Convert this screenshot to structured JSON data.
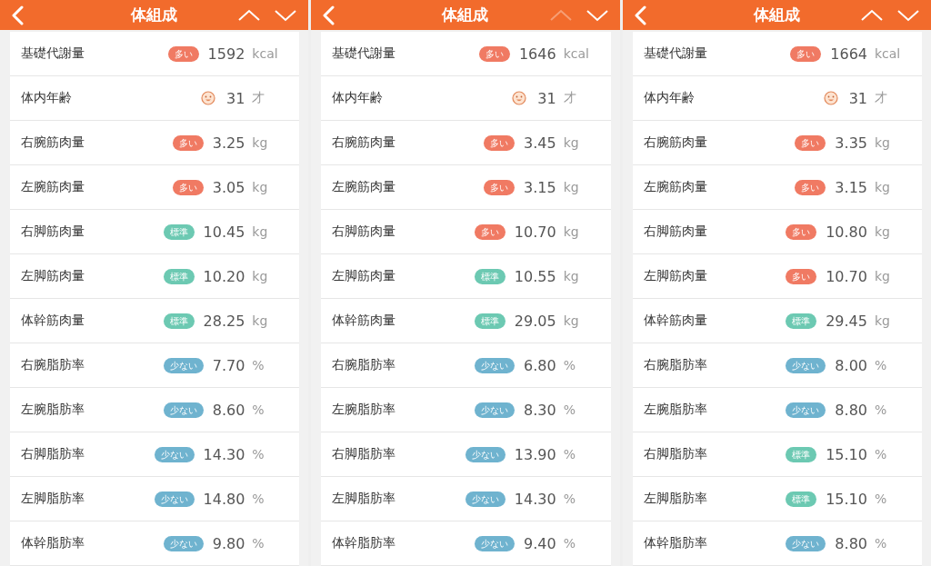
{
  "panels": [
    {
      "title": "体組成",
      "nav_up_disabled": false,
      "nav_down_disabled": false,
      "rows": [
        {
          "kind": "badge",
          "label": "基礎代謝量",
          "badge": {
            "text": "多い",
            "color": "#f07a63"
          },
          "value": "1592",
          "unit": "kcal"
        },
        {
          "kind": "face",
          "label": "体内年齢",
          "value": "31",
          "unit": "才"
        },
        {
          "kind": "badge",
          "label": "右腕筋肉量",
          "badge": {
            "text": "多い",
            "color": "#f07a63"
          },
          "value": "3.25",
          "unit": "kg"
        },
        {
          "kind": "badge",
          "label": "左腕筋肉量",
          "badge": {
            "text": "多い",
            "color": "#f07a63"
          },
          "value": "3.05",
          "unit": "kg"
        },
        {
          "kind": "badge",
          "label": "右脚筋肉量",
          "badge": {
            "text": "標準",
            "color": "#6cc9b2"
          },
          "value": "10.45",
          "unit": "kg"
        },
        {
          "kind": "badge",
          "label": "左脚筋肉量",
          "badge": {
            "text": "標準",
            "color": "#6cc9b2"
          },
          "value": "10.20",
          "unit": "kg"
        },
        {
          "kind": "badge",
          "label": "体幹筋肉量",
          "badge": {
            "text": "標準",
            "color": "#6cc9b2"
          },
          "value": "28.25",
          "unit": "kg"
        },
        {
          "kind": "badge",
          "label": "右腕脂肪率",
          "badge": {
            "text": "少ない",
            "color": "#6fb3cf"
          },
          "value": "7.70",
          "unit": "%"
        },
        {
          "kind": "badge",
          "label": "左腕脂肪率",
          "badge": {
            "text": "少ない",
            "color": "#6fb3cf"
          },
          "value": "8.60",
          "unit": "%"
        },
        {
          "kind": "badge",
          "label": "右脚脂肪率",
          "badge": {
            "text": "少ない",
            "color": "#6fb3cf"
          },
          "value": "14.30",
          "unit": "%"
        },
        {
          "kind": "badge",
          "label": "左脚脂肪率",
          "badge": {
            "text": "少ない",
            "color": "#6fb3cf"
          },
          "value": "14.80",
          "unit": "%"
        },
        {
          "kind": "badge",
          "label": "体幹脂肪率",
          "badge": {
            "text": "少ない",
            "color": "#6fb3cf"
          },
          "value": "9.80",
          "unit": "%"
        }
      ]
    },
    {
      "title": "体組成",
      "nav_up_disabled": true,
      "nav_down_disabled": false,
      "rows": [
        {
          "kind": "badge",
          "label": "基礎代謝量",
          "badge": {
            "text": "多い",
            "color": "#f07a63"
          },
          "value": "1646",
          "unit": "kcal"
        },
        {
          "kind": "face",
          "label": "体内年齢",
          "value": "31",
          "unit": "才"
        },
        {
          "kind": "badge",
          "label": "右腕筋肉量",
          "badge": {
            "text": "多い",
            "color": "#f07a63"
          },
          "value": "3.45",
          "unit": "kg"
        },
        {
          "kind": "badge",
          "label": "左腕筋肉量",
          "badge": {
            "text": "多い",
            "color": "#f07a63"
          },
          "value": "3.15",
          "unit": "kg"
        },
        {
          "kind": "badge",
          "label": "右脚筋肉量",
          "badge": {
            "text": "多い",
            "color": "#f07a63"
          },
          "value": "10.70",
          "unit": "kg"
        },
        {
          "kind": "badge",
          "label": "左脚筋肉量",
          "badge": {
            "text": "標準",
            "color": "#6cc9b2"
          },
          "value": "10.55",
          "unit": "kg"
        },
        {
          "kind": "badge",
          "label": "体幹筋肉量",
          "badge": {
            "text": "標準",
            "color": "#6cc9b2"
          },
          "value": "29.05",
          "unit": "kg"
        },
        {
          "kind": "badge",
          "label": "右腕脂肪率",
          "badge": {
            "text": "少ない",
            "color": "#6fb3cf"
          },
          "value": "6.80",
          "unit": "%"
        },
        {
          "kind": "badge",
          "label": "左腕脂肪率",
          "badge": {
            "text": "少ない",
            "color": "#6fb3cf"
          },
          "value": "8.30",
          "unit": "%"
        },
        {
          "kind": "badge",
          "label": "右脚脂肪率",
          "badge": {
            "text": "少ない",
            "color": "#6fb3cf"
          },
          "value": "13.90",
          "unit": "%"
        },
        {
          "kind": "badge",
          "label": "左脚脂肪率",
          "badge": {
            "text": "少ない",
            "color": "#6fb3cf"
          },
          "value": "14.30",
          "unit": "%"
        },
        {
          "kind": "badge",
          "label": "体幹脂肪率",
          "badge": {
            "text": "少ない",
            "color": "#6fb3cf"
          },
          "value": "9.40",
          "unit": "%"
        }
      ]
    },
    {
      "title": "体組成",
      "nav_up_disabled": false,
      "nav_down_disabled": false,
      "rows": [
        {
          "kind": "badge",
          "label": "基礎代謝量",
          "badge": {
            "text": "多い",
            "color": "#f07a63"
          },
          "value": "1664",
          "unit": "kcal"
        },
        {
          "kind": "face",
          "label": "体内年齢",
          "value": "31",
          "unit": "才"
        },
        {
          "kind": "badge",
          "label": "右腕筋肉量",
          "badge": {
            "text": "多い",
            "color": "#f07a63"
          },
          "value": "3.35",
          "unit": "kg"
        },
        {
          "kind": "badge",
          "label": "左腕筋肉量",
          "badge": {
            "text": "多い",
            "color": "#f07a63"
          },
          "value": "3.15",
          "unit": "kg"
        },
        {
          "kind": "badge",
          "label": "右脚筋肉量",
          "badge": {
            "text": "多い",
            "color": "#f07a63"
          },
          "value": "10.80",
          "unit": "kg"
        },
        {
          "kind": "badge",
          "label": "左脚筋肉量",
          "badge": {
            "text": "多い",
            "color": "#f07a63"
          },
          "value": "10.70",
          "unit": "kg"
        },
        {
          "kind": "badge",
          "label": "体幹筋肉量",
          "badge": {
            "text": "標準",
            "color": "#6cc9b2"
          },
          "value": "29.45",
          "unit": "kg"
        },
        {
          "kind": "badge",
          "label": "右腕脂肪率",
          "badge": {
            "text": "少ない",
            "color": "#6fb3cf"
          },
          "value": "8.00",
          "unit": "%"
        },
        {
          "kind": "badge",
          "label": "左腕脂肪率",
          "badge": {
            "text": "少ない",
            "color": "#6fb3cf"
          },
          "value": "8.80",
          "unit": "%"
        },
        {
          "kind": "badge",
          "label": "右脚脂肪率",
          "badge": {
            "text": "標準",
            "color": "#6cc9b2"
          },
          "value": "15.10",
          "unit": "%"
        },
        {
          "kind": "badge",
          "label": "左脚脂肪率",
          "badge": {
            "text": "標準",
            "color": "#6cc9b2"
          },
          "value": "15.10",
          "unit": "%"
        },
        {
          "kind": "badge",
          "label": "体幹脂肪率",
          "badge": {
            "text": "少ない",
            "color": "#6fb3cf"
          },
          "value": "8.80",
          "unit": "%"
        }
      ]
    }
  ]
}
